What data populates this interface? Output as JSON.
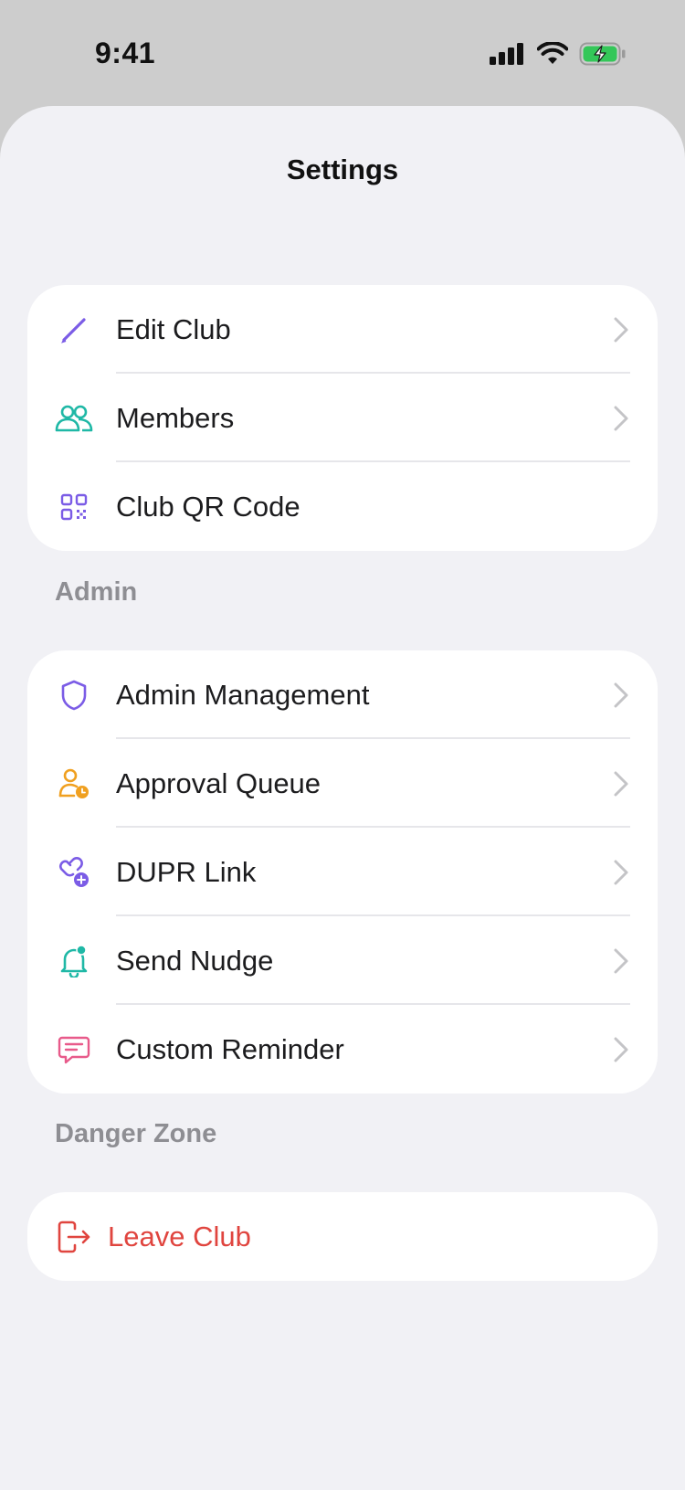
{
  "status_bar": {
    "time": "9:41"
  },
  "title": "Settings",
  "groups": [
    {
      "header": "",
      "items": [
        {
          "label": "Edit Club",
          "icon": "pencil-icon",
          "chevron": true
        },
        {
          "label": "Members",
          "icon": "people-icon",
          "chevron": true
        },
        {
          "label": "Club QR Code",
          "icon": "qr-code-icon",
          "chevron": false
        }
      ]
    },
    {
      "header": "Admin",
      "items": [
        {
          "label": "Admin Management",
          "icon": "shield-icon",
          "chevron": true
        },
        {
          "label": "Approval Queue",
          "icon": "user-clock-icon",
          "chevron": true
        },
        {
          "label": "DUPR Link",
          "icon": "link-plus-icon",
          "chevron": true
        },
        {
          "label": "Send Nudge",
          "icon": "bell-dot-icon",
          "chevron": true
        },
        {
          "label": "Custom Reminder",
          "icon": "message-icon",
          "chevron": true
        }
      ]
    },
    {
      "header": "Danger Zone",
      "items": [
        {
          "label": "Leave Club",
          "icon": "logout-icon",
          "chevron": false
        }
      ]
    }
  ],
  "colors": {
    "purple": "#7b5ce6",
    "teal": "#1fb8a6",
    "orange": "#f0a020",
    "pink": "#e85a8a",
    "danger": "#e0453f",
    "battery": "#34c759"
  }
}
